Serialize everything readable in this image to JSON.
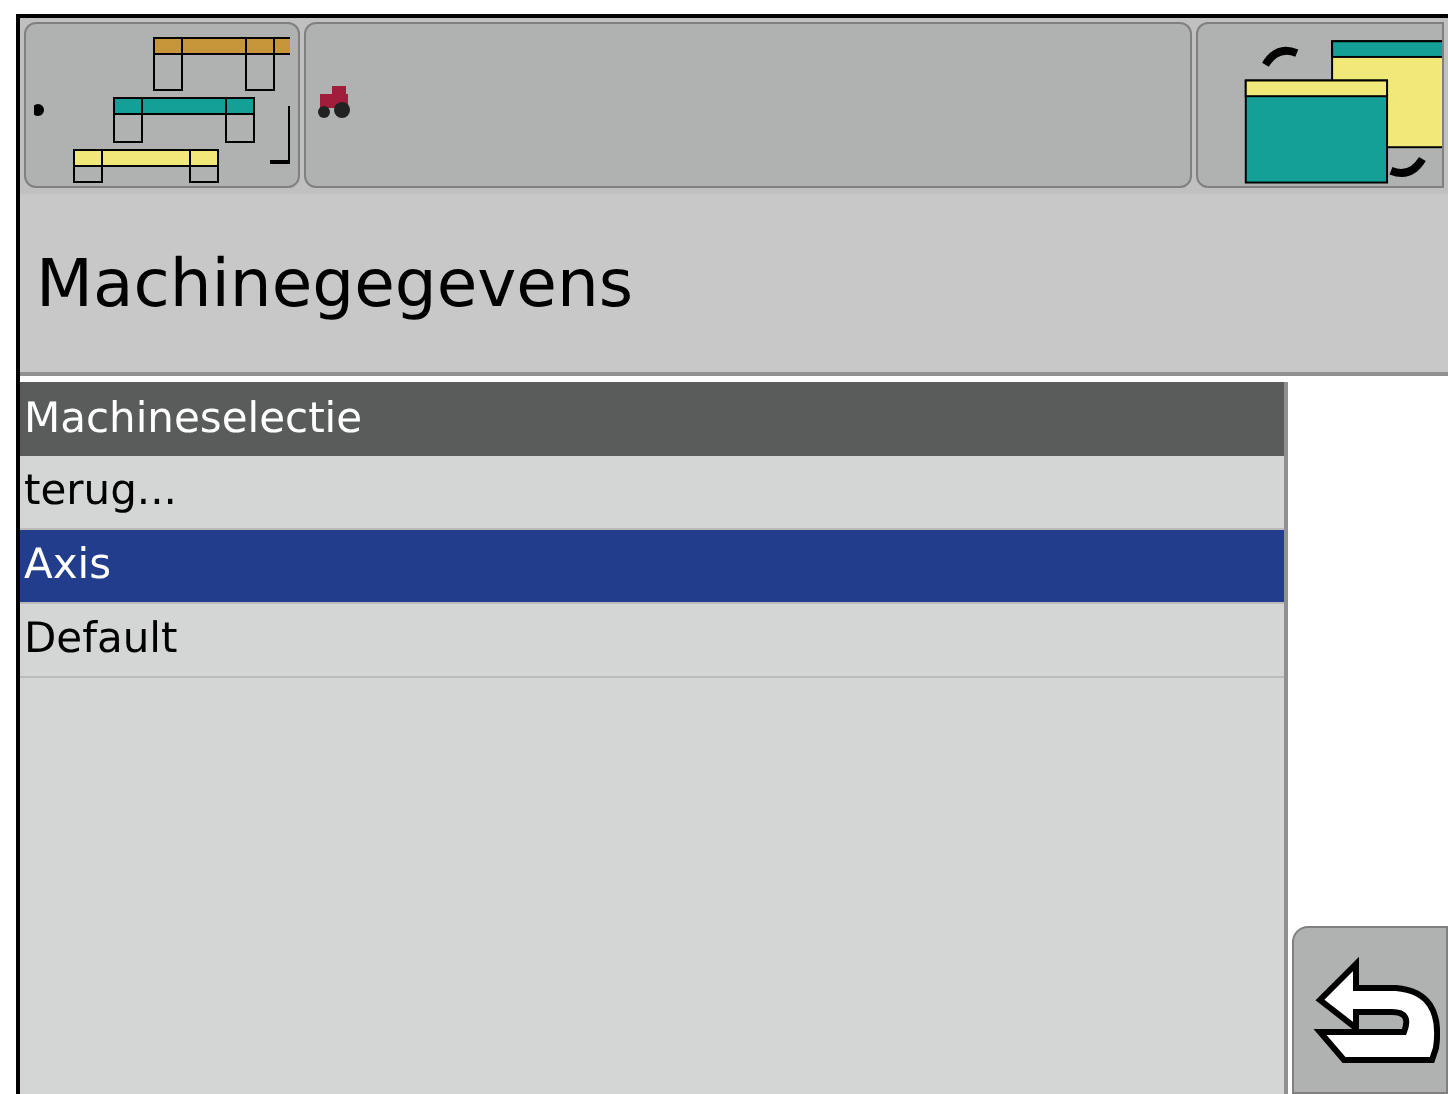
{
  "title": "Machinegegevens",
  "list": {
    "header": "Machineselectie",
    "items": [
      {
        "label": "terug...",
        "selected": false
      },
      {
        "label": "Axis",
        "selected": true
      },
      {
        "label": "Default",
        "selected": false
      }
    ]
  }
}
